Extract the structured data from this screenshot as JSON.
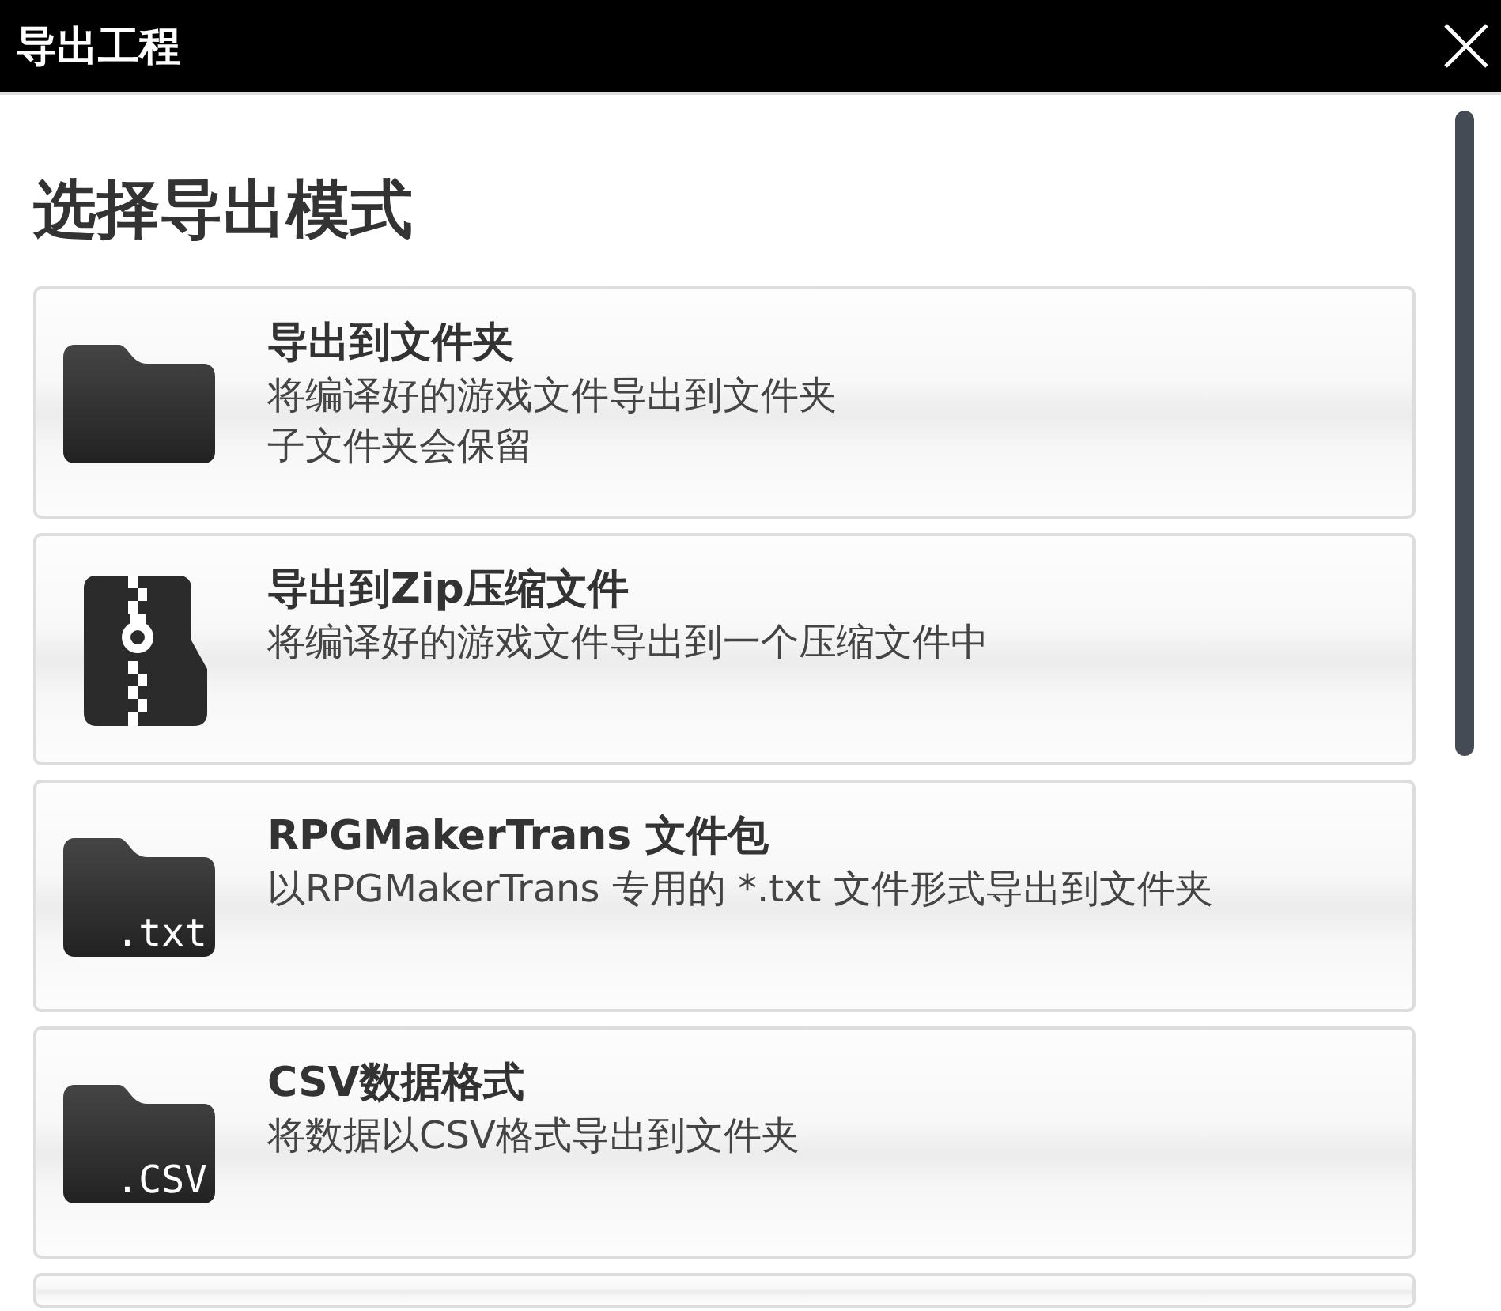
{
  "window": {
    "title": "导出工程"
  },
  "heading": "选择导出模式",
  "options": [
    {
      "kind": "folder",
      "title": "导出到文件夹",
      "lines": [
        "将编译好的游戏文件导出到文件夹",
        "子文件夹会保留"
      ]
    },
    {
      "kind": "zip",
      "title": "导出到Zip压缩文件",
      "lines": [
        "将编译好的游戏文件导出到一个压缩文件中"
      ]
    },
    {
      "kind": "labeled-folder",
      "icon_label": ".txt",
      "title": "RPGMakerTrans 文件包",
      "lines": [
        "以RPGMakerTrans 专用的 *.txt 文件形式导出到文件夹"
      ]
    },
    {
      "kind": "labeled-folder",
      "icon_label": ".CSV",
      "title": "CSV数据格式",
      "lines": [
        "将数据以CSV格式导出到文件夹"
      ]
    }
  ]
}
